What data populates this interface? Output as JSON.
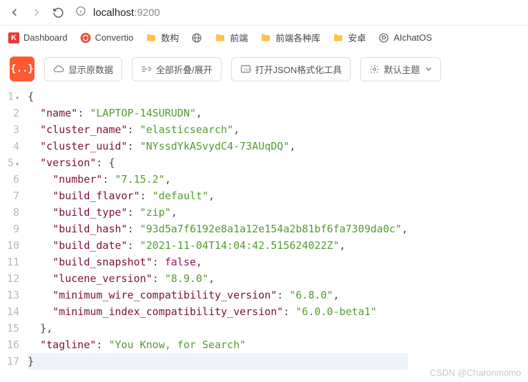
{
  "url": {
    "host": "localhost",
    "port": ":9200"
  },
  "bookmarks": [
    {
      "label": "Dashboard",
      "icon": "k"
    },
    {
      "label": "Convertio",
      "icon": "convertio"
    },
    {
      "label": "数构",
      "icon": "folder"
    },
    {
      "label": "",
      "icon": "globe"
    },
    {
      "label": "前端",
      "icon": "folder"
    },
    {
      "label": "前端各种库",
      "icon": "folder"
    },
    {
      "label": "安卓",
      "icon": "folder"
    },
    {
      "label": "AIchatOS",
      "icon": "ai"
    }
  ],
  "toolbar": {
    "raw": "显示原数据",
    "collapse": "全部折叠/展开",
    "open": "打开JSON格式化工具",
    "theme": "默认主题"
  },
  "json": {
    "name": "LAPTOP-14SURUDN",
    "cluster_name": "elasticsearch",
    "cluster_uuid": "NYssdYkASvydC4-73AUqDQ",
    "version": {
      "number": "7.15.2",
      "build_flavor": "default",
      "build_type": "zip",
      "build_hash": "93d5a7f6192e8a1a12e154a2b81bf6fa7309da0c",
      "build_date": "2021-11-04T14:04:42.515624022Z",
      "build_snapshot": "false",
      "lucene_version": "8.9.0",
      "minimum_wire_compatibility_version": "6.8.0",
      "minimum_index_compatibility_version": "6.0.0-beta1"
    },
    "tagline": "You Know, for Search"
  },
  "watermark": "CSDN @Charonmomo"
}
